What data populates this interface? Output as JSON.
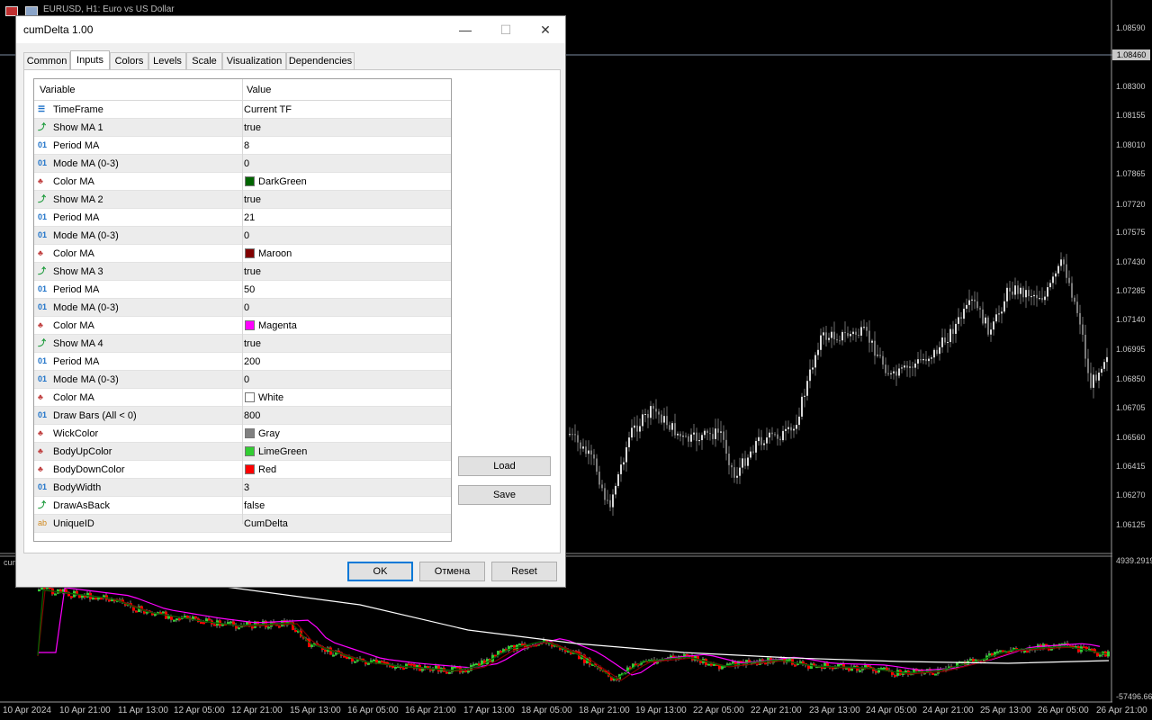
{
  "window": {
    "title": "EURUSD, H1:  Euro vs US Dollar"
  },
  "price_axis": [
    "1.08590",
    "1.08460",
    "1.08300",
    "1.08155",
    "1.08010",
    "1.07865",
    "1.07720",
    "1.07575",
    "1.07430",
    "1.07285",
    "1.07140",
    "1.06995",
    "1.06850",
    "1.06705",
    "1.06560",
    "1.06415",
    "1.06270",
    "1.06125"
  ],
  "current_price": "1.08460",
  "sub_axis": {
    "top": "4939.2919",
    "bottom": "-57496.66"
  },
  "sub_window_name": "cum",
  "time_axis": [
    "10 Apr 2024",
    "10 Apr 21:00",
    "11 Apr 13:00",
    "12 Apr 05:00",
    "12 Apr 21:00",
    "15 Apr 13:00",
    "16 Apr 05:00",
    "16 Apr 21:00",
    "17 Apr 13:00",
    "18 Apr 05:00",
    "18 Apr 21:00",
    "19 Apr 13:00",
    "22 Apr 05:00",
    "22 Apr 21:00",
    "23 Apr 13:00",
    "24 Apr 05:00",
    "24 Apr 21:00",
    "25 Apr 13:00",
    "26 Apr 05:00",
    "26 Apr 21:00"
  ],
  "dialog": {
    "title": "cumDelta 1.00",
    "minimize": "—",
    "maximize": "☐",
    "close": "✕",
    "tabs": [
      "Common",
      "Inputs",
      "Colors",
      "Levels",
      "Scale",
      "Visualization",
      "Dependencies"
    ],
    "active_tab": "Inputs",
    "columns": {
      "variable": "Variable",
      "value": "Value"
    },
    "rows": [
      {
        "name": "TimeFrame",
        "value": "Current TF",
        "icon": "enum"
      },
      {
        "name": "Show MA 1",
        "value": "true",
        "icon": "bool"
      },
      {
        "name": "Period MA",
        "value": "8",
        "icon": "num"
      },
      {
        "name": "Mode MA (0-3)",
        "value": "0",
        "icon": "num"
      },
      {
        "name": "Color MA",
        "value": "DarkGreen",
        "icon": "color",
        "color": "#006400"
      },
      {
        "name": "Show MA 2",
        "value": "true",
        "icon": "bool"
      },
      {
        "name": "Period MA",
        "value": "21",
        "icon": "num"
      },
      {
        "name": "Mode MA (0-3)",
        "value": "0",
        "icon": "num"
      },
      {
        "name": "Color MA",
        "value": "Maroon",
        "icon": "color",
        "color": "#800000"
      },
      {
        "name": "Show MA 3",
        "value": "true",
        "icon": "bool"
      },
      {
        "name": "Period MA",
        "value": "50",
        "icon": "num"
      },
      {
        "name": "Mode MA (0-3)",
        "value": "0",
        "icon": "num"
      },
      {
        "name": "Color MA",
        "value": "Magenta",
        "icon": "color",
        "color": "#ff00ff"
      },
      {
        "name": "Show MA 4",
        "value": "true",
        "icon": "bool"
      },
      {
        "name": "Period MA",
        "value": "200",
        "icon": "num"
      },
      {
        "name": "Mode MA (0-3)",
        "value": "0",
        "icon": "num"
      },
      {
        "name": "Color MA",
        "value": "White",
        "icon": "color",
        "color": "#ffffff"
      },
      {
        "name": "Draw Bars (All < 0)",
        "value": "800",
        "icon": "num"
      },
      {
        "name": "WickColor",
        "value": "Gray",
        "icon": "color",
        "color": "#808080"
      },
      {
        "name": "BodyUpColor",
        "value": "LimeGreen",
        "icon": "color",
        "color": "#32cd32"
      },
      {
        "name": "BodyDownColor",
        "value": "Red",
        "icon": "color",
        "color": "#ff0000"
      },
      {
        "name": "BodyWidth",
        "value": "3",
        "icon": "num"
      },
      {
        "name": "DrawAsBack",
        "value": "false",
        "icon": "bool"
      },
      {
        "name": "UniqueID",
        "value": "CumDelta",
        "icon": "str"
      }
    ],
    "load": "Load",
    "save": "Save",
    "ok": "OK",
    "cancel": "Отмена",
    "reset": "Reset"
  }
}
